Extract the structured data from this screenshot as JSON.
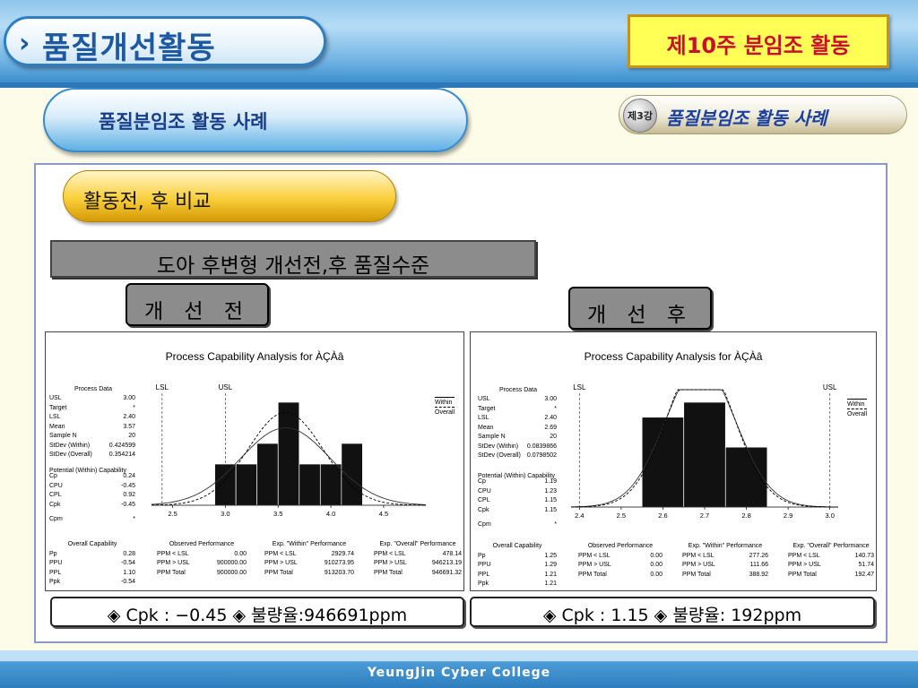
{
  "header": {
    "title": "품질개선활동",
    "week": "제10주  분임조  활동"
  },
  "section": {
    "title": "품질분임조 활동 사례"
  },
  "lecture": {
    "badge": "제3강",
    "title": "품질분임조 활동 사례"
  },
  "content": {
    "compare_heading": "활동전, 후 비교",
    "topic": "도아 후변형 개선전,후 품질수준",
    "before_label": "개 선 전",
    "after_label": "개 선 후",
    "before_result": "◈ Cpk : −0.45  ◈ 불량율:946691ppm",
    "after_result": "◈ Cpk : 1.15  ◈ 불량율: 192ppm"
  },
  "footer": {
    "text": "YeungJin Cyber College"
  },
  "chart_data": [
    {
      "type": "bar",
      "title": "Process Capability Analysis for ÀÇÀâ",
      "limits": {
        "LSL": 2.4,
        "USL": 3.0
      },
      "x_ticks": [
        "2.5",
        "3.0",
        "3.5",
        "4.0",
        "4.5"
      ],
      "xlim": [
        2.3,
        4.9
      ],
      "bins": [
        {
          "from": 2.9,
          "to": 3.1,
          "count": 2
        },
        {
          "from": 3.1,
          "to": 3.3,
          "count": 2
        },
        {
          "from": 3.3,
          "to": 3.5,
          "count": 3
        },
        {
          "from": 3.5,
          "to": 3.7,
          "count": 5
        },
        {
          "from": 3.7,
          "to": 3.9,
          "count": 2
        },
        {
          "from": 3.9,
          "to": 4.1,
          "count": 2
        },
        {
          "from": 4.1,
          "to": 4.3,
          "count": 3
        }
      ],
      "legend": [
        "Within",
        "Overall"
      ],
      "process_data": {
        "heading": "Process Data",
        "rows": [
          [
            "USL",
            "3.00"
          ],
          [
            "Target",
            "*"
          ],
          [
            "LSL",
            "2.40"
          ],
          [
            "Mean",
            "3.57"
          ],
          [
            "Sample N",
            "20"
          ],
          [
            "StDev (Within)",
            "0.424599"
          ],
          [
            "StDev (Overall)",
            "0.354214"
          ]
        ]
      },
      "potential": {
        "heading": "Potential (Within) Capability",
        "rows": [
          [
            "Cp",
            "0.24"
          ],
          [
            "CPU",
            "-0.45"
          ],
          [
            "CPL",
            "0.92"
          ],
          [
            "Cpk",
            "-0.45"
          ],
          [
            "Cpm",
            "*"
          ]
        ]
      },
      "overall": {
        "heading": "Overall Capability",
        "rows": [
          [
            "Pp",
            "0.28"
          ],
          [
            "PPU",
            "-0.54"
          ],
          [
            "PPL",
            "1.10"
          ],
          [
            "Ppk",
            "-0.54"
          ]
        ]
      },
      "observed": {
        "heading": "Observed Performance",
        "rows": [
          [
            "PPM < LSL",
            "0.00"
          ],
          [
            "PPM > USL",
            "900000.00"
          ],
          [
            "PPM Total",
            "900000.00"
          ]
        ]
      },
      "exp_within": {
        "heading": "Exp. \"Within\" Performance",
        "rows": [
          [
            "PPM < LSL",
            "2929.74"
          ],
          [
            "PPM > USL",
            "910273.95"
          ],
          [
            "PPM Total",
            "913203.70"
          ]
        ]
      },
      "exp_overall": {
        "heading": "Exp. \"Overall\" Performance",
        "rows": [
          [
            "PPM < LSL",
            "478.14"
          ],
          [
            "PPM > USL",
            "946213.19"
          ],
          [
            "PPM Total",
            "946691.32"
          ]
        ]
      }
    },
    {
      "type": "bar",
      "title": "Process Capability Analysis for ÀÇÀâ",
      "limits": {
        "LSL": 2.4,
        "USL": 3.0
      },
      "x_ticks": [
        "2.4",
        "2.5",
        "2.6",
        "2.7",
        "2.8",
        "2.9",
        "3.0"
      ],
      "xlim": [
        2.38,
        3.02
      ],
      "bins": [
        {
          "from": 2.55,
          "to": 2.65,
          "count": 6
        },
        {
          "from": 2.65,
          "to": 2.75,
          "count": 7
        },
        {
          "from": 2.75,
          "to": 2.85,
          "count": 4
        }
      ],
      "legend": [
        "Within",
        "Overall"
      ],
      "process_data": {
        "heading": "Process Data",
        "rows": [
          [
            "USL",
            "3.00"
          ],
          [
            "Target",
            "*"
          ],
          [
            "LSL",
            "2.40"
          ],
          [
            "Mean",
            "2.69"
          ],
          [
            "Sample N",
            "20"
          ],
          [
            "StDev (Within)",
            "0.0839866"
          ],
          [
            "StDev (Overall)",
            "0.0798502"
          ]
        ]
      },
      "potential": {
        "heading": "Potential (Within) Capability",
        "rows": [
          [
            "Cp",
            "1.19"
          ],
          [
            "CPU",
            "1.23"
          ],
          [
            "CPL",
            "1.15"
          ],
          [
            "Cpk",
            "1.15"
          ],
          [
            "Cpm",
            "*"
          ]
        ]
      },
      "overall": {
        "heading": "Overall Capability",
        "rows": [
          [
            "Pp",
            "1.25"
          ],
          [
            "PPU",
            "1.29"
          ],
          [
            "PPL",
            "1.21"
          ],
          [
            "Ppk",
            "1.21"
          ]
        ]
      },
      "observed": {
        "heading": "Observed Performance",
        "rows": [
          [
            "PPM < LSL",
            "0.00"
          ],
          [
            "PPM > USL",
            "0.00"
          ],
          [
            "PPM Total",
            "0.00"
          ]
        ]
      },
      "exp_within": {
        "heading": "Exp. \"Within\" Performance",
        "rows": [
          [
            "PPM < LSL",
            "277.26"
          ],
          [
            "PPM > USL",
            "111.66"
          ],
          [
            "PPM Total",
            "388.92"
          ]
        ]
      },
      "exp_overall": {
        "heading": "Exp. \"Overall\" Performance",
        "rows": [
          [
            "PPM < LSL",
            "140.73"
          ],
          [
            "PPM > USL",
            "51.74"
          ],
          [
            "PPM Total",
            "192.47"
          ]
        ]
      }
    }
  ]
}
